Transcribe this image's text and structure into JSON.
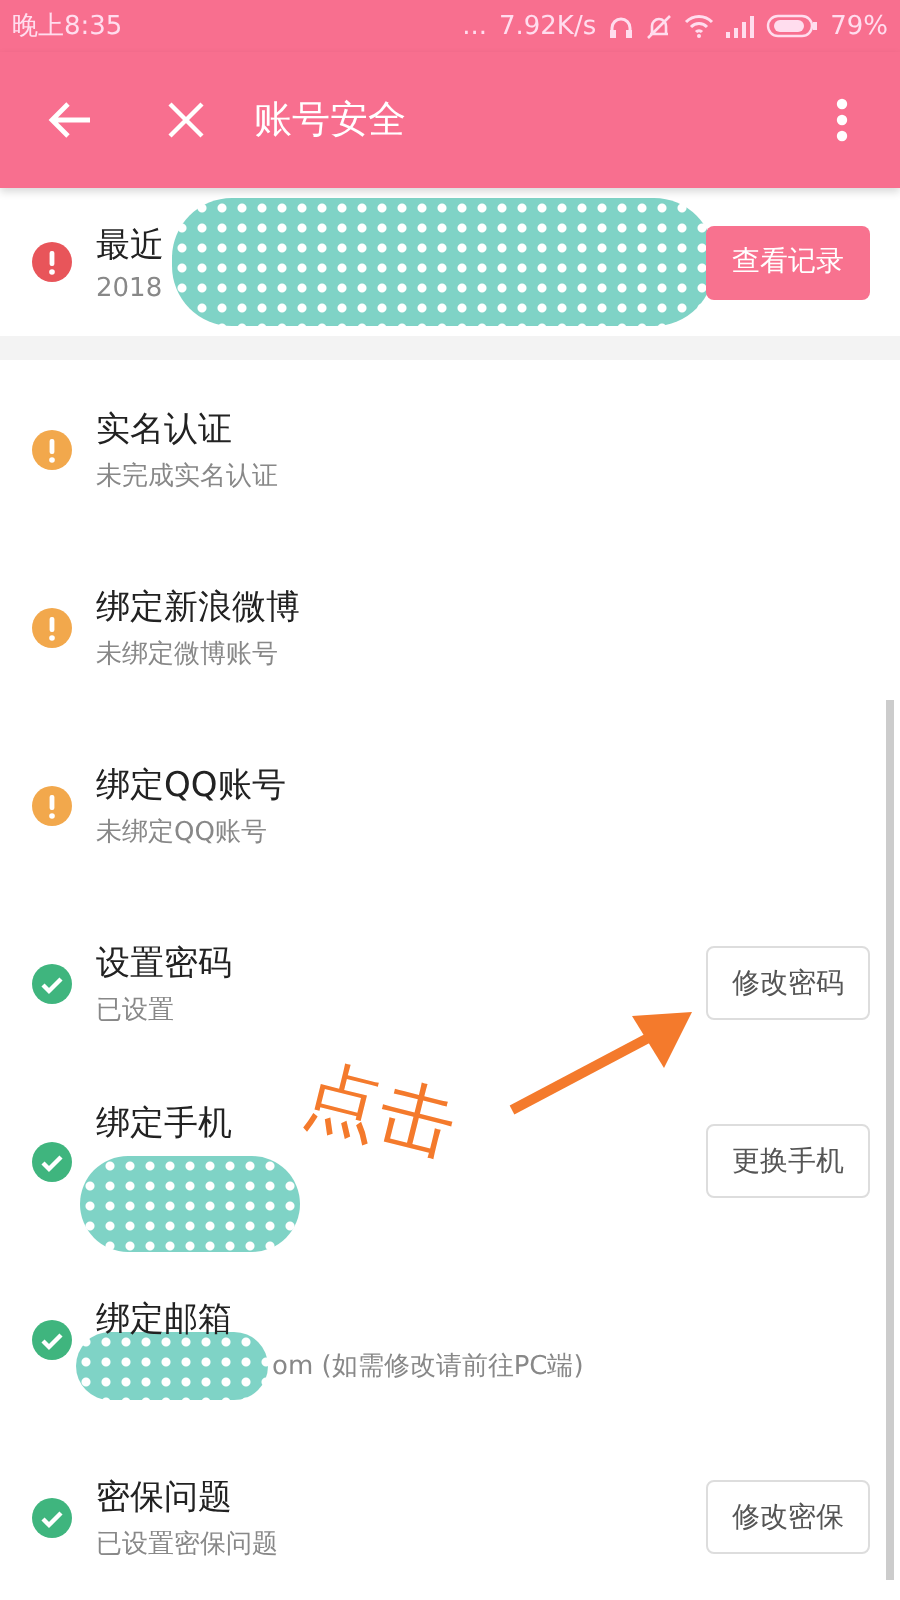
{
  "status_bar": {
    "time": "晚上8:35",
    "dots": "...",
    "speed": "7.92K/s",
    "battery": "79%"
  },
  "app_bar": {
    "title": "账号安全"
  },
  "items": [
    {
      "kind": "danger",
      "title": "最近",
      "subtitle": "2018",
      "title_redacted": true,
      "subtitle_redacted": false,
      "button": {
        "label": "查看记录",
        "kind": "primary"
      },
      "gap_after": true
    },
    {
      "kind": "warning",
      "title": "实名认证",
      "subtitle": "未完成实名认证",
      "gap_after": false
    },
    {
      "kind": "warning",
      "title": "绑定新浪微博",
      "subtitle": "未绑定微博账号",
      "gap_after": false
    },
    {
      "kind": "warning",
      "title": "绑定QQ账号",
      "subtitle": "未绑定QQ账号",
      "gap_after": false
    },
    {
      "kind": "ok",
      "title": "设置密码",
      "subtitle": "已设置",
      "button": {
        "label": "修改密码",
        "kind": "default"
      },
      "gap_after": false
    },
    {
      "kind": "ok",
      "title": "绑定手机",
      "title_redacted": false,
      "subtitle_redacted": true,
      "button": {
        "label": "更换手机",
        "kind": "default"
      },
      "gap_after": false
    },
    {
      "kind": "ok",
      "title": "绑定邮箱",
      "subtitle": "om (如需修改请前往PC端)",
      "title_redacted": false,
      "subtitle_redacted": true,
      "gap_after": false
    },
    {
      "kind": "ok",
      "title": "密保问题",
      "subtitle": "已设置密保问题",
      "button": {
        "label": "修改密保",
        "kind": "default"
      },
      "gap_after": false
    }
  ],
  "annotation": {
    "text": "点击"
  }
}
